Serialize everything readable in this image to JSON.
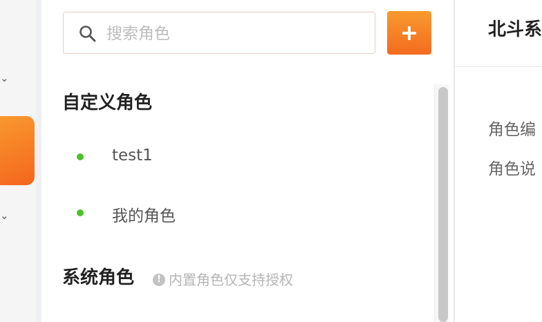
{
  "nav": {
    "chevron_glyph": "⌄",
    "active_color": "#f4661e"
  },
  "search": {
    "placeholder": "搜索角色",
    "value": ""
  },
  "add_button": {
    "label": "+"
  },
  "custom_roles": {
    "title": "自定义角色",
    "items": [
      {
        "label": "test1",
        "status_color": "#4ac22c"
      },
      {
        "label": "我的角色",
        "status_color": "#4ac22c"
      }
    ]
  },
  "system_roles": {
    "title": "系统角色",
    "hint_icon": "!",
    "hint": "内置角色仅支持授权"
  },
  "detail": {
    "title": "北斗系",
    "fields": [
      "角色编",
      "角色说"
    ]
  }
}
